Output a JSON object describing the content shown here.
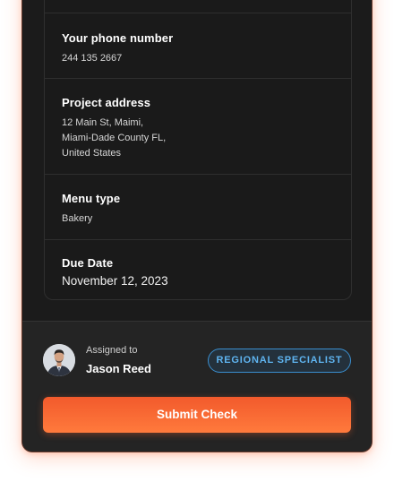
{
  "details": {
    "phone": {
      "label": "Your phone number",
      "value": "244 135 2667"
    },
    "address": {
      "label": "Project address",
      "lines": [
        "12 Main St, Maimi,",
        "Miami-Dade County FL,",
        "United States"
      ]
    },
    "menu": {
      "label": "Menu type",
      "value": "Bakery"
    },
    "due": {
      "label": "Due Date",
      "value": "November 12, 2023"
    }
  },
  "assignment": {
    "assigned_label": "Assigned to",
    "name": "Jason Reed",
    "role": "REGIONAL SPECIALIST"
  },
  "actions": {
    "submit_label": "Submit Check"
  },
  "colors": {
    "card_background": "#1b1b1b",
    "footer_background": "#242424",
    "accent": "#f25a2c",
    "badge": "#5fb4f0"
  }
}
